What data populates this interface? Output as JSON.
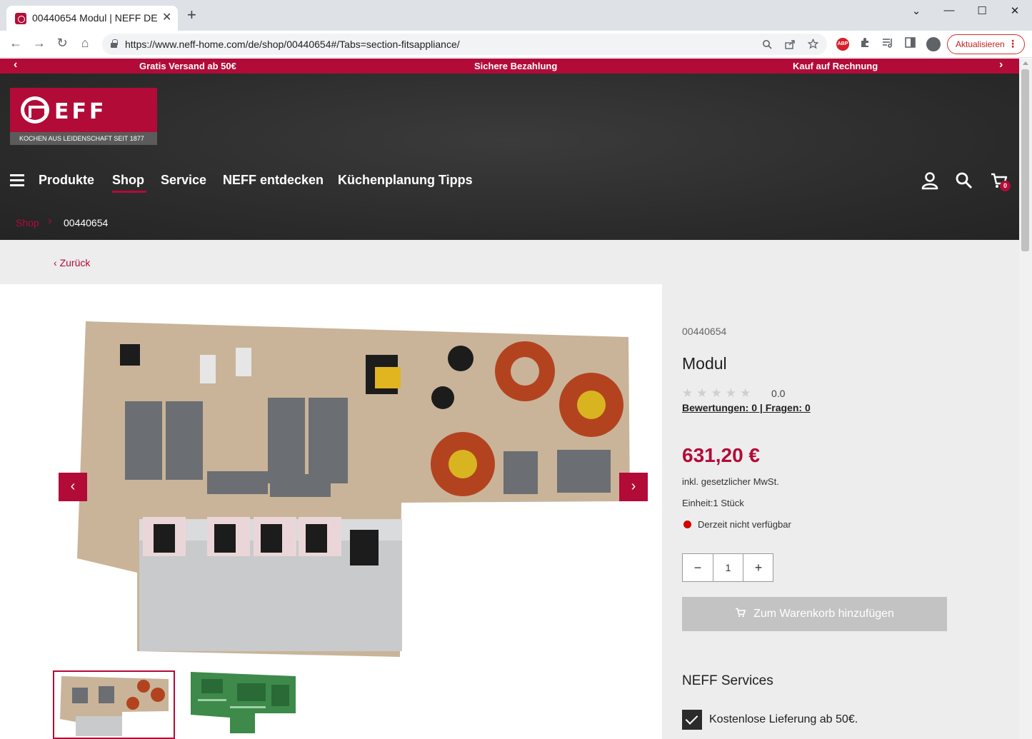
{
  "browser": {
    "tab_title": "00440654 Modul | NEFF DE",
    "tab_close": "✕",
    "new_tab": "+",
    "url": "https://www.neff-home.com/de/shop/00440654#/Tabs=section-fitsappliance/",
    "update_label": "Aktualisieren",
    "update_menu": "⋮",
    "abp_label": "ABP",
    "window_controls": {
      "minimize": "—",
      "maximize": "☐",
      "close": "✕",
      "tabsearch": "⌄"
    },
    "nav_icons": {
      "back": "←",
      "forward": "→",
      "reload": "↻",
      "home": "⌂"
    }
  },
  "promo": {
    "items": [
      "Gratis Versand ab 50€",
      "Sichere Bezahlung",
      "Kauf auf Rechnung"
    ],
    "prev": "‹",
    "next": "›"
  },
  "header": {
    "logo_word": "EFF",
    "tagline": "KOCHEN AUS LEIDENSCHAFT SEIT 1877",
    "nav": [
      "Produkte",
      "Shop",
      "Service",
      "NEFF entdecken",
      "Küchenplanung Tipps"
    ],
    "active_nav": "Shop",
    "cart_count": "0"
  },
  "breadcrumb": {
    "items": [
      "Shop",
      "00440654"
    ],
    "separator": "›"
  },
  "page": {
    "back_label": "Zurück",
    "back_arrow": "‹"
  },
  "gallery": {
    "prev": "‹",
    "next": "›",
    "thumbnail_count": 2
  },
  "product": {
    "sku": "00440654",
    "name": "Modul",
    "stars": "★★★★★",
    "rating": "0.0",
    "reviews_link": "Bewertungen: 0 | Fragen: 0",
    "price": "631,20 €",
    "tax_note": "inkl. gesetzlicher MwSt.",
    "unit": "Einheit:1 Stück",
    "availability": "Derzeit nicht verfügbar",
    "quantity": "1",
    "qty_minus": "−",
    "qty_plus": "+",
    "add_to_cart": "Zum Warenkorb hinzufügen",
    "cart_icon": "🛒"
  },
  "services": {
    "title": "NEFF Services",
    "items": [
      "Kostenlose Lieferung ab 50€."
    ]
  },
  "colors": {
    "brand_red": "#b20b38",
    "header_dark": "#2a2a2a",
    "content_bg": "#ededed",
    "button_disabled": "#c3c3c3"
  }
}
